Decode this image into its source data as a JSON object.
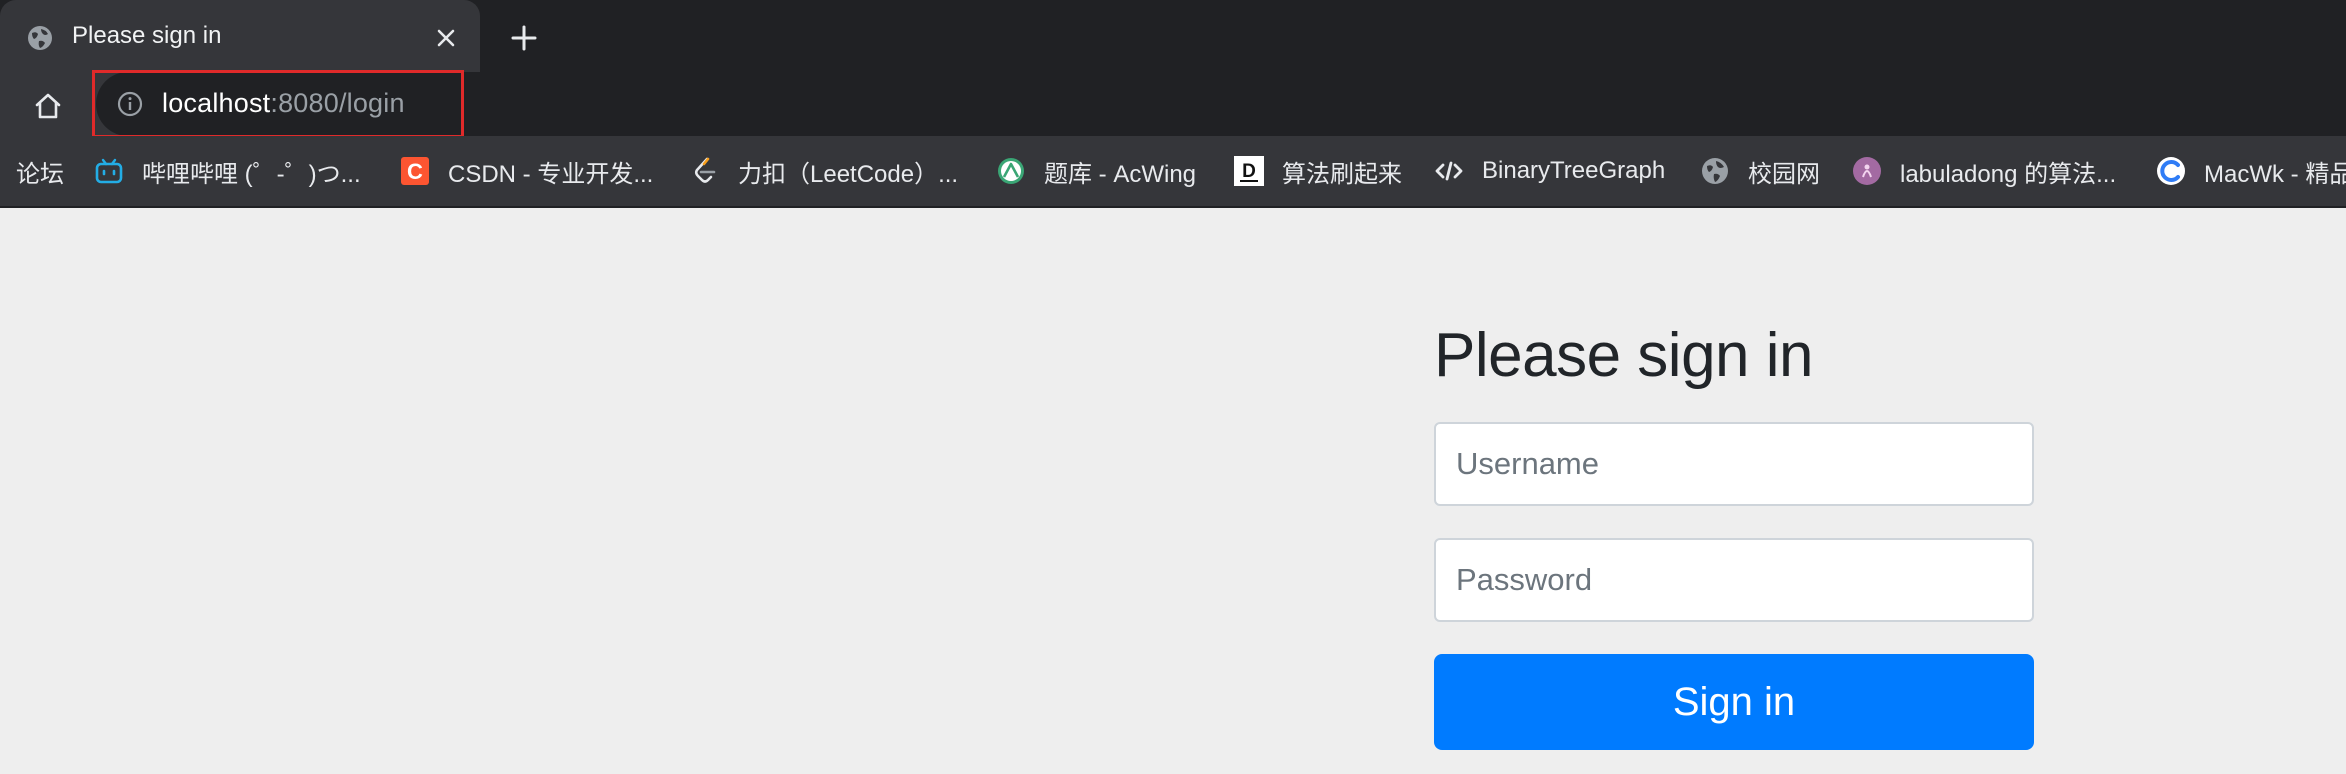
{
  "browser": {
    "tab": {
      "title": "Please sign in"
    },
    "address_bar": {
      "host": "localhost",
      "rest": ":8080/login"
    },
    "bookmarks": [
      {
        "label": "论坛",
        "icon": "none"
      },
      {
        "label": "哔哩哔哩 (゜-゜)つ...",
        "icon": "bilibili-icon"
      },
      {
        "label": "CSDN - 专业开发...",
        "icon": "csdn-icon"
      },
      {
        "label": "力扣（LeetCode）...",
        "icon": "leetcode-icon"
      },
      {
        "label": "题库 - AcWing",
        "icon": "acwing-icon"
      },
      {
        "label": "算法刷起来",
        "icon": "d-logo-icon"
      },
      {
        "label": "BinaryTreeGraph",
        "icon": "code-icon"
      },
      {
        "label": "校园网",
        "icon": "globe-icon"
      },
      {
        "label": "labuladong 的算法...",
        "icon": "labuladong-icon"
      },
      {
        "label": "MacWk - 精品",
        "icon": "macwk-icon"
      }
    ]
  },
  "login_form": {
    "heading": "Please sign in",
    "username_placeholder": "Username",
    "password_placeholder": "Password",
    "submit_label": "Sign in"
  },
  "colors": {
    "primary_button": "#007bff",
    "page_background": "#eeeeee",
    "address_highlight": "#e02a2a"
  }
}
